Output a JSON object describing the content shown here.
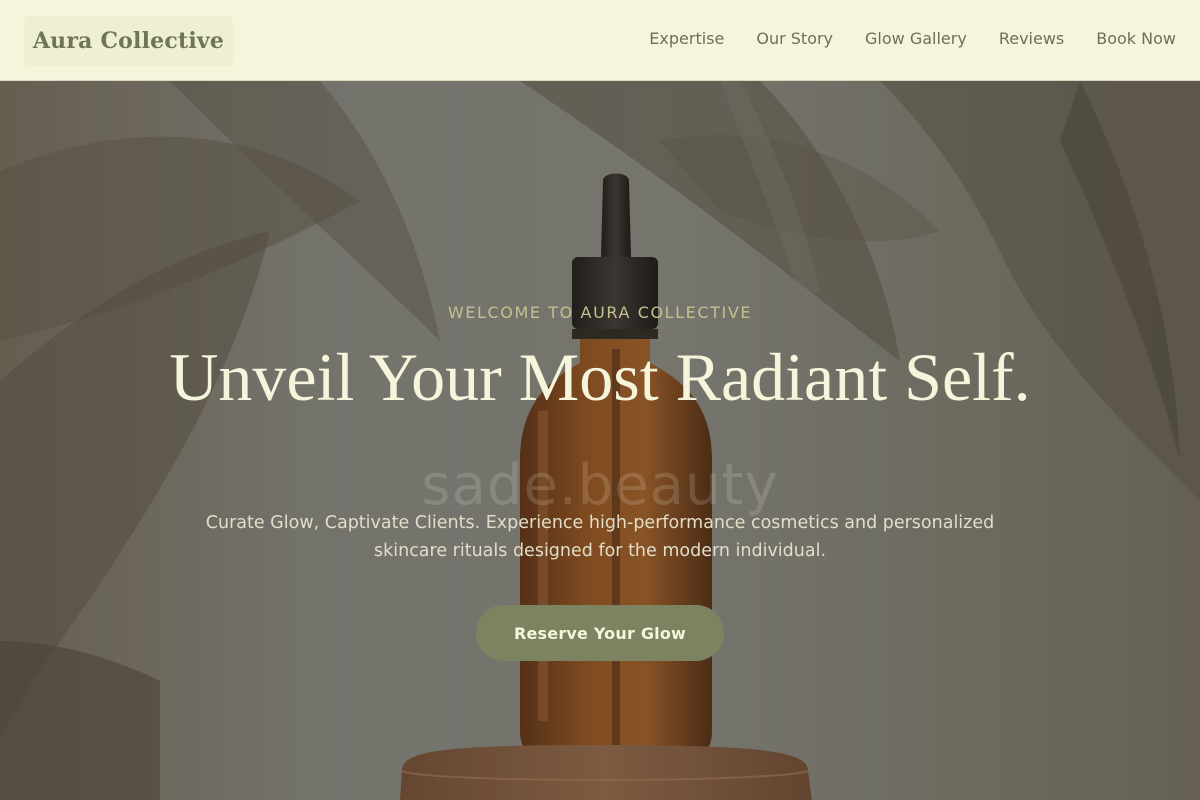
{
  "header": {
    "brand": "Aura Collective",
    "nav": [
      "Expertise",
      "Our Story",
      "Glow Gallery",
      "Reviews",
      "Book Now"
    ]
  },
  "hero": {
    "eyebrow": "WELCOME TO AURA COLLECTIVE",
    "headline": "Unveil Your Most Radiant Self.",
    "watermark": "sade.beauty",
    "subtitle": "Curate Glow, Captivate Clients. Experience high-performance cosmetics and personalized skincare rituals designed for the modern individual.",
    "cta": "Reserve Your Glow"
  },
  "colors": {
    "cream": "#f5f5dc",
    "olive": "#7b8360",
    "brand_text": "#6f7653",
    "nav_text": "#6c6f5a",
    "eyebrow": "#c6c08f"
  }
}
